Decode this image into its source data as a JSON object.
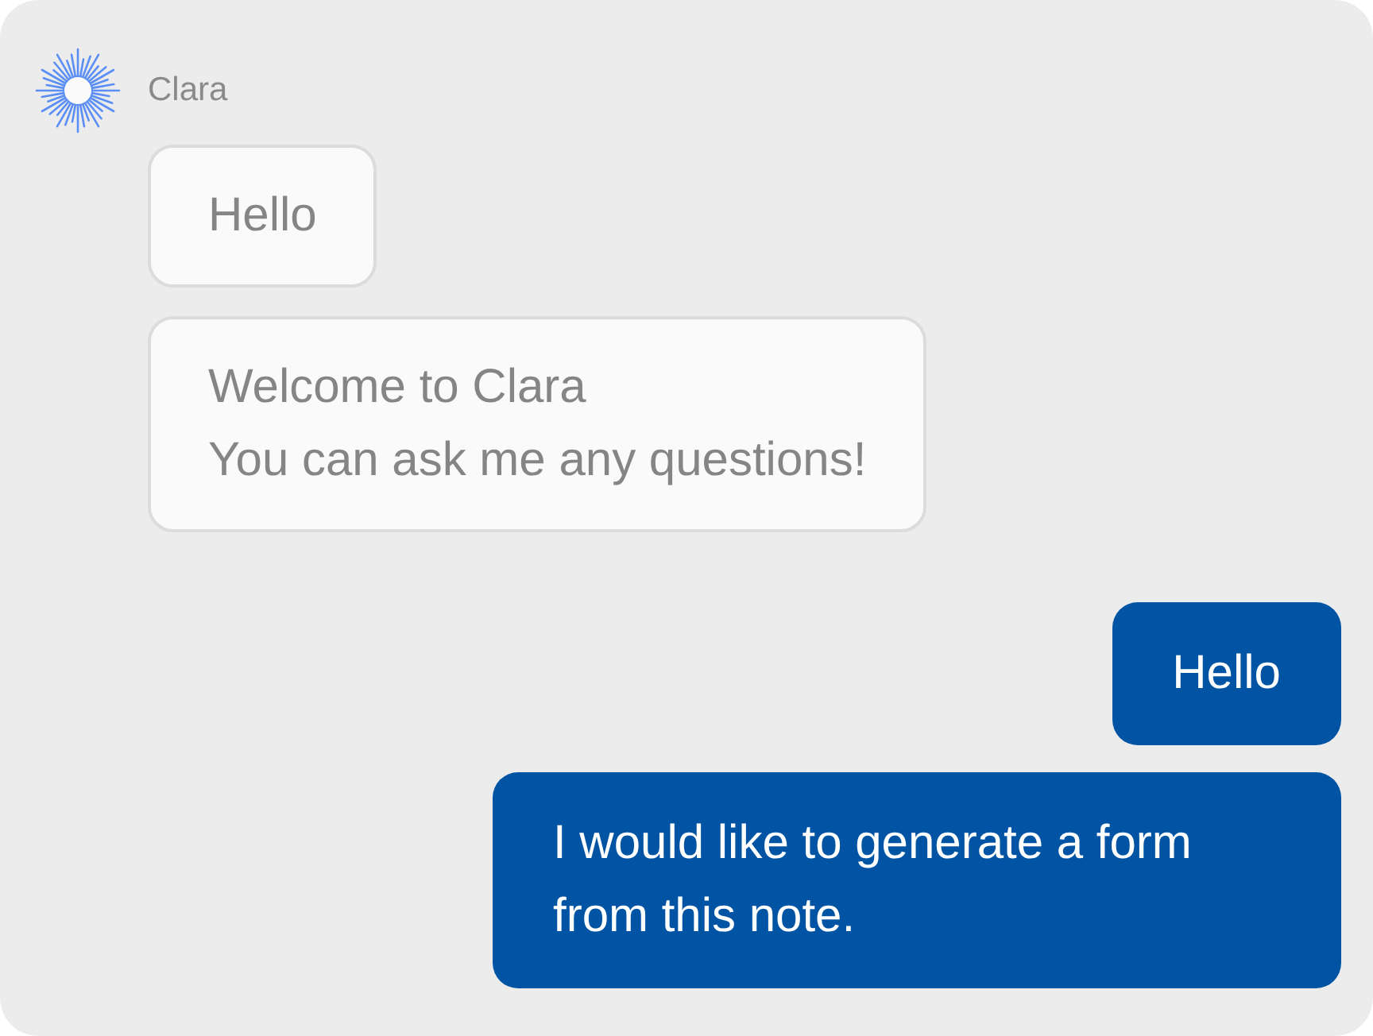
{
  "assistant": {
    "name": "Clara"
  },
  "messages": [
    {
      "kind": "incoming",
      "text": "Hello"
    },
    {
      "kind": "incoming",
      "text": "Welcome to Clara\nYou can ask me any questions!"
    },
    {
      "kind": "outgoing",
      "text": "Hello"
    },
    {
      "kind": "outgoing",
      "text": "I would like to generate a form from this note."
    }
  ]
}
